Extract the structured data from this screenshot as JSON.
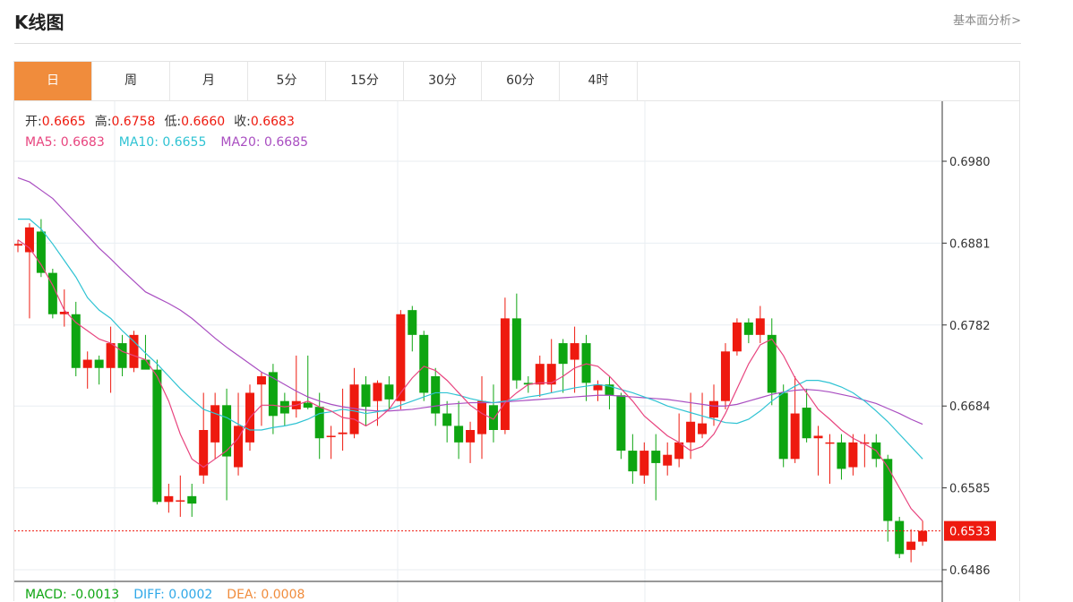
{
  "header": {
    "title": "K线图",
    "more_label": "基本面分析>"
  },
  "tabs": [
    {
      "label": "日",
      "active": true
    },
    {
      "label": "周",
      "active": false
    },
    {
      "label": "月",
      "active": false
    },
    {
      "label": "5分",
      "active": false
    },
    {
      "label": "15分",
      "active": false
    },
    {
      "label": "30分",
      "active": false
    },
    {
      "label": "60分",
      "active": false
    },
    {
      "label": "4时",
      "active": false
    }
  ],
  "colors": {
    "up": "#ee1a0f",
    "down": "#0ea511",
    "ma5": "#e8457f",
    "ma10": "#2fc3d3",
    "ma20": "#a94ec1",
    "accent": "#f08c3c",
    "macd": "#0ea511",
    "diff": "#2fa8e8",
    "dea": "#f08c3c"
  },
  "chart_data": {
    "type": "candlestick",
    "ohlc_labels": {
      "open": "开:",
      "high": "高:",
      "low": "低:",
      "close": "收:"
    },
    "ohlc_values": {
      "open": "0.6665",
      "high": "0.6758",
      "low": "0.6660",
      "close": "0.6683"
    },
    "ma_labels": [
      {
        "label": "MA5: ",
        "value": "0.6683"
      },
      {
        "label": "MA10: ",
        "value": "0.6655"
      },
      {
        "label": "MA20: ",
        "value": "0.6685"
      }
    ],
    "y_ticks": [
      "0.6980",
      "0.6881",
      "0.6782",
      "0.6684",
      "0.6585",
      "0.6486"
    ],
    "current_price": "0.6533",
    "ylim": [
      0.647,
      0.705
    ],
    "candles": [
      [
        0.6878,
        0.6885,
        0.687,
        0.688
      ],
      [
        0.687,
        0.6905,
        0.679,
        0.69
      ],
      [
        0.6895,
        0.691,
        0.684,
        0.6845
      ],
      [
        0.6845,
        0.685,
        0.679,
        0.6795
      ],
      [
        0.6795,
        0.6825,
        0.678,
        0.6798
      ],
      [
        0.6795,
        0.681,
        0.672,
        0.673
      ],
      [
        0.673,
        0.675,
        0.6705,
        0.674
      ],
      [
        0.674,
        0.6745,
        0.671,
        0.673
      ],
      [
        0.673,
        0.678,
        0.67,
        0.676
      ],
      [
        0.676,
        0.677,
        0.672,
        0.673
      ],
      [
        0.673,
        0.6775,
        0.6725,
        0.677
      ],
      [
        0.674,
        0.677,
        0.673,
        0.6728
      ],
      [
        0.6728,
        0.674,
        0.6565,
        0.6568
      ],
      [
        0.6568,
        0.659,
        0.6555,
        0.6575
      ],
      [
        0.657,
        0.66,
        0.655,
        0.657
      ],
      [
        0.6575,
        0.659,
        0.655,
        0.6566
      ],
      [
        0.66,
        0.67,
        0.659,
        0.6655
      ],
      [
        0.664,
        0.67,
        0.662,
        0.6685
      ],
      [
        0.6685,
        0.6705,
        0.657,
        0.6623
      ],
      [
        0.661,
        0.67,
        0.66,
        0.666
      ],
      [
        0.664,
        0.671,
        0.663,
        0.67
      ],
      [
        0.671,
        0.6725,
        0.666,
        0.672
      ],
      [
        0.6725,
        0.6735,
        0.665,
        0.6672
      ],
      [
        0.669,
        0.67,
        0.666,
        0.6675
      ],
      [
        0.668,
        0.6745,
        0.667,
        0.669
      ],
      [
        0.6688,
        0.6745,
        0.668,
        0.6682
      ],
      [
        0.6683,
        0.67,
        0.662,
        0.6645
      ],
      [
        0.6648,
        0.666,
        0.662,
        0.6648
      ],
      [
        0.665,
        0.6705,
        0.663,
        0.6652
      ],
      [
        0.665,
        0.673,
        0.6645,
        0.671
      ],
      [
        0.671,
        0.672,
        0.666,
        0.6683
      ],
      [
        0.669,
        0.6715,
        0.666,
        0.6712
      ],
      [
        0.671,
        0.672,
        0.668,
        0.6692
      ],
      [
        0.669,
        0.68,
        0.668,
        0.6795
      ],
      [
        0.68,
        0.6805,
        0.675,
        0.677
      ],
      [
        0.677,
        0.6775,
        0.669,
        0.67
      ],
      [
        0.672,
        0.673,
        0.666,
        0.6675
      ],
      [
        0.6675,
        0.669,
        0.664,
        0.666
      ],
      [
        0.666,
        0.669,
        0.662,
        0.664
      ],
      [
        0.664,
        0.6665,
        0.6615,
        0.6655
      ],
      [
        0.665,
        0.672,
        0.662,
        0.669
      ],
      [
        0.6685,
        0.671,
        0.664,
        0.6655
      ],
      [
        0.6655,
        0.6815,
        0.665,
        0.679
      ],
      [
        0.679,
        0.682,
        0.6705,
        0.6715
      ],
      [
        0.6712,
        0.672,
        0.67,
        0.671
      ],
      [
        0.671,
        0.6745,
        0.6695,
        0.6735
      ],
      [
        0.671,
        0.6765,
        0.67,
        0.6735
      ],
      [
        0.676,
        0.6765,
        0.67,
        0.6735
      ],
      [
        0.674,
        0.678,
        0.67,
        0.676
      ],
      [
        0.676,
        0.677,
        0.669,
        0.6712
      ],
      [
        0.6703,
        0.6715,
        0.669,
        0.671
      ],
      [
        0.671,
        0.672,
        0.668,
        0.6697
      ],
      [
        0.6697,
        0.67,
        0.662,
        0.663
      ],
      [
        0.663,
        0.665,
        0.659,
        0.6605
      ],
      [
        0.66,
        0.664,
        0.659,
        0.663
      ],
      [
        0.663,
        0.665,
        0.657,
        0.6615
      ],
      [
        0.6612,
        0.664,
        0.66,
        0.6625
      ],
      [
        0.662,
        0.6675,
        0.661,
        0.664
      ],
      [
        0.664,
        0.67,
        0.662,
        0.6665
      ],
      [
        0.665,
        0.67,
        0.6645,
        0.6663
      ],
      [
        0.667,
        0.671,
        0.666,
        0.669
      ],
      [
        0.669,
        0.676,
        0.668,
        0.675
      ],
      [
        0.675,
        0.679,
        0.6745,
        0.6785
      ],
      [
        0.6785,
        0.679,
        0.676,
        0.677
      ],
      [
        0.677,
        0.6805,
        0.676,
        0.679
      ],
      [
        0.677,
        0.679,
        0.6685,
        0.67
      ],
      [
        0.67,
        0.671,
        0.661,
        0.662
      ],
      [
        0.662,
        0.672,
        0.6615,
        0.6675
      ],
      [
        0.6682,
        0.6705,
        0.664,
        0.6645
      ],
      [
        0.6645,
        0.666,
        0.66,
        0.6648
      ],
      [
        0.664,
        0.665,
        0.659,
        0.664
      ],
      [
        0.664,
        0.665,
        0.6595,
        0.6608
      ],
      [
        0.661,
        0.665,
        0.66,
        0.664
      ],
      [
        0.664,
        0.665,
        0.661,
        0.664
      ],
      [
        0.664,
        0.665,
        0.661,
        0.662
      ],
      [
        0.662,
        0.6625,
        0.652,
        0.6545
      ],
      [
        0.6545,
        0.655,
        0.65,
        0.6505
      ],
      [
        0.651,
        0.6535,
        0.6495,
        0.652
      ],
      [
        0.652,
        0.6545,
        0.6515,
        0.6533
      ]
    ],
    "ma5": [
      0.6885,
      0.6875,
      0.6855,
      0.683,
      0.68,
      0.6785,
      0.6775,
      0.6765,
      0.676,
      0.675,
      0.6745,
      0.674,
      0.672,
      0.669,
      0.665,
      0.662,
      0.661,
      0.662,
      0.663,
      0.6645,
      0.667,
      0.6685,
      0.6685,
      0.6683,
      0.6685,
      0.669,
      0.6683,
      0.6678,
      0.667,
      0.6668,
      0.666,
      0.6668,
      0.668,
      0.67,
      0.6718,
      0.6732,
      0.6727,
      0.6715,
      0.67,
      0.6685,
      0.6675,
      0.6668,
      0.6688,
      0.67,
      0.671,
      0.6712,
      0.6712,
      0.672,
      0.673,
      0.6735,
      0.6732,
      0.672,
      0.6705,
      0.669,
      0.6672,
      0.666,
      0.6648,
      0.664,
      0.663,
      0.6635,
      0.665,
      0.6675,
      0.6705,
      0.6735,
      0.6758,
      0.6765,
      0.6745,
      0.6718,
      0.67,
      0.668,
      0.6668,
      0.6655,
      0.6645,
      0.6638,
      0.663,
      0.661,
      0.6585,
      0.656,
      0.6545
    ],
    "ma10": [
      0.691,
      0.691,
      0.6898,
      0.688,
      0.686,
      0.684,
      0.6815,
      0.68,
      0.679,
      0.6775,
      0.6762,
      0.6748,
      0.6735,
      0.672,
      0.6705,
      0.6692,
      0.668,
      0.6675,
      0.667,
      0.6662,
      0.6655,
      0.6655,
      0.6658,
      0.666,
      0.6663,
      0.6668,
      0.6675,
      0.6677,
      0.668,
      0.6678,
      0.6675,
      0.6677,
      0.668,
      0.6685,
      0.669,
      0.6695,
      0.67,
      0.67,
      0.6697,
      0.6693,
      0.669,
      0.6688,
      0.669,
      0.6692,
      0.6695,
      0.6697,
      0.67,
      0.6703,
      0.6706,
      0.6708,
      0.671,
      0.6708,
      0.6704,
      0.67,
      0.6695,
      0.669,
      0.6684,
      0.668,
      0.6676,
      0.6672,
      0.6668,
      0.6664,
      0.6663,
      0.6668,
      0.6678,
      0.669,
      0.67,
      0.6708,
      0.6715,
      0.6715,
      0.6712,
      0.6707,
      0.67,
      0.669,
      0.6678,
      0.6665,
      0.665,
      0.6635,
      0.662
    ],
    "ma20": [
      0.696,
      0.6955,
      0.6945,
      0.6935,
      0.692,
      0.6905,
      0.689,
      0.6875,
      0.6862,
      0.6848,
      0.6835,
      0.6822,
      0.6815,
      0.6808,
      0.68,
      0.679,
      0.6778,
      0.6766,
      0.6755,
      0.6745,
      0.6735,
      0.6725,
      0.6718,
      0.671,
      0.6702,
      0.6695,
      0.669,
      0.6686,
      0.6683,
      0.6681,
      0.6679,
      0.6678,
      0.6678,
      0.6679,
      0.668,
      0.6682,
      0.6684,
      0.6686,
      0.6687,
      0.6688,
      0.6688,
      0.6688,
      0.6689,
      0.669,
      0.6691,
      0.6692,
      0.6693,
      0.6694,
      0.6695,
      0.6696,
      0.6697,
      0.6697,
      0.6696,
      0.6695,
      0.6694,
      0.6693,
      0.6692,
      0.669,
      0.6688,
      0.6686,
      0.6684,
      0.6684,
      0.6686,
      0.669,
      0.6694,
      0.6698,
      0.6701,
      0.6703,
      0.6704,
      0.6703,
      0.6701,
      0.6698,
      0.6695,
      0.6691,
      0.6687,
      0.6681,
      0.6675,
      0.6668,
      0.6662
    ],
    "macd_labels": [
      {
        "label": "MACD: ",
        "value": "-0.0013"
      },
      {
        "label": "DIFF: ",
        "value": "0.0002"
      },
      {
        "label": "DEA: ",
        "value": "0.0008"
      }
    ]
  }
}
